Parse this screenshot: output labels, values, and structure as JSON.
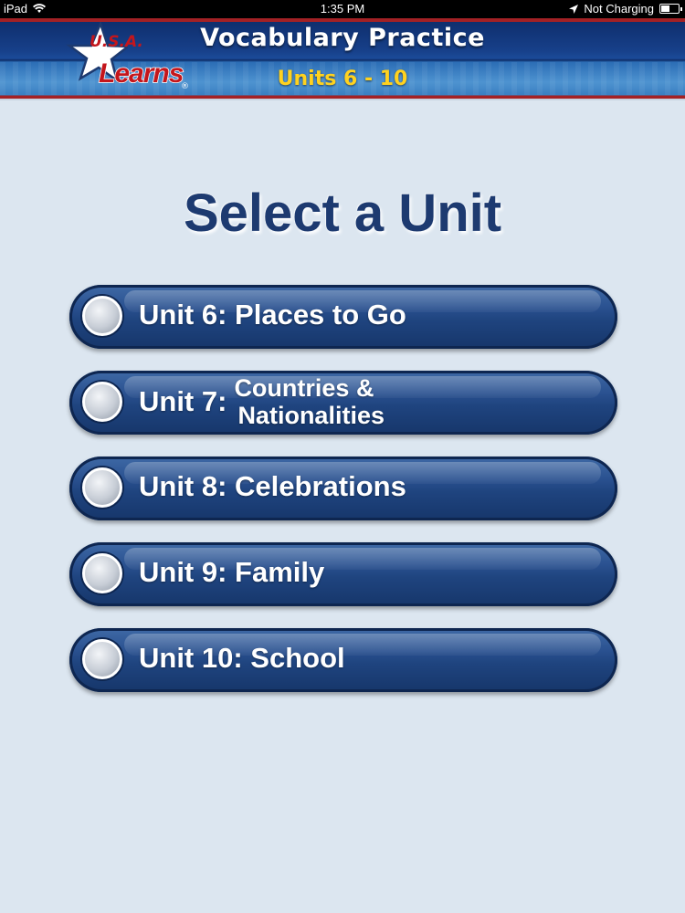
{
  "status_bar": {
    "device": "iPad",
    "time": "1:35 PM",
    "charging": "Not Charging"
  },
  "header": {
    "title": "Vocabulary Practice",
    "subtitle": "Units 6 - 10",
    "logo": {
      "usa": "U.S.A.",
      "learns": "Learns",
      "reg": "®"
    }
  },
  "page_title": "Select a Unit",
  "units": [
    {
      "label": "Unit 6: Places to Go"
    },
    {
      "prefix": "Unit 7:",
      "line1": "Countries &",
      "line2": "Nationalities"
    },
    {
      "label": "Unit 8: Celebrations"
    },
    {
      "label": "Unit 9: Family"
    },
    {
      "label": "Unit 10: School"
    }
  ],
  "colors": {
    "header_red": "#a32125",
    "header_blue": "#17408a",
    "subtitle_yellow": "#ffd21f",
    "button_blue": "#2a5190",
    "title_navy": "#1d3a70",
    "background": "#dce6f0"
  }
}
